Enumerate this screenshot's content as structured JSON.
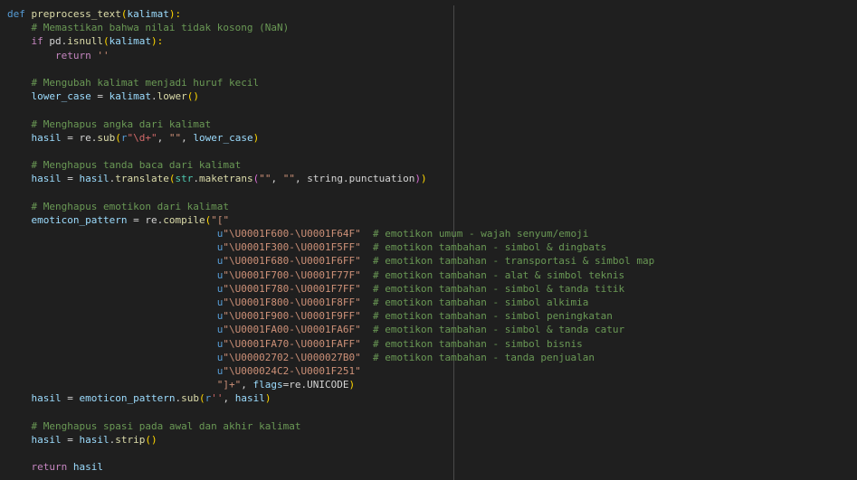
{
  "editor": {
    "lines": [
      [
        {
          "t": "def",
          "c": "kw"
        },
        {
          "t": " ",
          "c": "pl"
        },
        {
          "t": "preprocess_text",
          "c": "fn"
        },
        {
          "t": "(",
          "c": "br1"
        },
        {
          "t": "kalimat",
          "c": "var"
        },
        {
          "t": "):",
          "c": "br1"
        }
      ],
      [
        {
          "t": "    ",
          "c": "pl"
        },
        {
          "t": "# Memastikan bahwa nilai tidak kosong (NaN)",
          "c": "cm"
        }
      ],
      [
        {
          "t": "    ",
          "c": "pl"
        },
        {
          "t": "if",
          "c": "ctl"
        },
        {
          "t": " pd.",
          "c": "pl"
        },
        {
          "t": "isnull",
          "c": "fn"
        },
        {
          "t": "(",
          "c": "br1"
        },
        {
          "t": "kalimat",
          "c": "var"
        },
        {
          "t": "):",
          "c": "br1"
        }
      ],
      [
        {
          "t": "        ",
          "c": "pl"
        },
        {
          "t": "return",
          "c": "ctl"
        },
        {
          "t": " ",
          "c": "pl"
        },
        {
          "t": "''",
          "c": "str"
        }
      ],
      [],
      [
        {
          "t": "    ",
          "c": "pl"
        },
        {
          "t": "# Mengubah kalimat menjadi huruf kecil",
          "c": "cm"
        }
      ],
      [
        {
          "t": "    ",
          "c": "pl"
        },
        {
          "t": "lower_case",
          "c": "var"
        },
        {
          "t": " = ",
          "c": "pl"
        },
        {
          "t": "kalimat",
          "c": "var"
        },
        {
          "t": ".",
          "c": "pl"
        },
        {
          "t": "lower",
          "c": "fn"
        },
        {
          "t": "()",
          "c": "br1"
        }
      ],
      [],
      [
        {
          "t": "    ",
          "c": "pl"
        },
        {
          "t": "# Menghapus angka dari kalimat",
          "c": "cm"
        }
      ],
      [
        {
          "t": "    ",
          "c": "pl"
        },
        {
          "t": "hasil",
          "c": "var"
        },
        {
          "t": " = re.",
          "c": "pl"
        },
        {
          "t": "sub",
          "c": "fn"
        },
        {
          "t": "(",
          "c": "br1"
        },
        {
          "t": "r",
          "c": "kw"
        },
        {
          "t": "\"\\d+\"",
          "c": "rx"
        },
        {
          "t": ", ",
          "c": "pl"
        },
        {
          "t": "\"\"",
          "c": "str"
        },
        {
          "t": ", ",
          "c": "pl"
        },
        {
          "t": "lower_case",
          "c": "var"
        },
        {
          "t": ")",
          "c": "br1"
        }
      ],
      [],
      [
        {
          "t": "    ",
          "c": "pl"
        },
        {
          "t": "# Menghapus tanda baca dari kalimat",
          "c": "cm"
        }
      ],
      [
        {
          "t": "    ",
          "c": "pl"
        },
        {
          "t": "hasil",
          "c": "var"
        },
        {
          "t": " = ",
          "c": "pl"
        },
        {
          "t": "hasil",
          "c": "var"
        },
        {
          "t": ".",
          "c": "pl"
        },
        {
          "t": "translate",
          "c": "fn"
        },
        {
          "t": "(",
          "c": "br1"
        },
        {
          "t": "str",
          "c": "bi"
        },
        {
          "t": ".",
          "c": "pl"
        },
        {
          "t": "maketrans",
          "c": "fn"
        },
        {
          "t": "(",
          "c": "br2"
        },
        {
          "t": "\"\"",
          "c": "str"
        },
        {
          "t": ", ",
          "c": "pl"
        },
        {
          "t": "\"\"",
          "c": "str"
        },
        {
          "t": ", string.punctuation",
          "c": "pl"
        },
        {
          "t": ")",
          "c": "br2"
        },
        {
          "t": ")",
          "c": "br1"
        }
      ],
      [],
      [
        {
          "t": "    ",
          "c": "pl"
        },
        {
          "t": "# Menghapus emotikon dari kalimat",
          "c": "cm"
        }
      ],
      [
        {
          "t": "    ",
          "c": "pl"
        },
        {
          "t": "emoticon_pattern",
          "c": "var"
        },
        {
          "t": " = re.",
          "c": "pl"
        },
        {
          "t": "compile",
          "c": "fn"
        },
        {
          "t": "(",
          "c": "br1"
        },
        {
          "t": "\"[\"",
          "c": "str"
        }
      ],
      [
        {
          "t": "                                   ",
          "c": "pl"
        },
        {
          "t": "u",
          "c": "kw"
        },
        {
          "t": "\"\\U0001F600-\\U0001F64F\"",
          "c": "str"
        },
        {
          "t": "  ",
          "c": "pl"
        },
        {
          "t": "# emotikon umum - wajah senyum/emoji",
          "c": "cm"
        }
      ],
      [
        {
          "t": "                                   ",
          "c": "pl"
        },
        {
          "t": "u",
          "c": "kw"
        },
        {
          "t": "\"\\U0001F300-\\U0001F5FF\"",
          "c": "str"
        },
        {
          "t": "  ",
          "c": "pl"
        },
        {
          "t": "# emotikon tambahan - simbol & dingbats",
          "c": "cm"
        }
      ],
      [
        {
          "t": "                                   ",
          "c": "pl"
        },
        {
          "t": "u",
          "c": "kw"
        },
        {
          "t": "\"\\U0001F680-\\U0001F6FF\"",
          "c": "str"
        },
        {
          "t": "  ",
          "c": "pl"
        },
        {
          "t": "# emotikon tambahan - transportasi & simbol map",
          "c": "cm"
        }
      ],
      [
        {
          "t": "                                   ",
          "c": "pl"
        },
        {
          "t": "u",
          "c": "kw"
        },
        {
          "t": "\"\\U0001F700-\\U0001F77F\"",
          "c": "str"
        },
        {
          "t": "  ",
          "c": "pl"
        },
        {
          "t": "# emotikon tambahan - alat & simbol teknis",
          "c": "cm"
        }
      ],
      [
        {
          "t": "                                   ",
          "c": "pl"
        },
        {
          "t": "u",
          "c": "kw"
        },
        {
          "t": "\"\\U0001F780-\\U0001F7FF\"",
          "c": "str"
        },
        {
          "t": "  ",
          "c": "pl"
        },
        {
          "t": "# emotikon tambahan - simbol & tanda titik",
          "c": "cm"
        }
      ],
      [
        {
          "t": "                                   ",
          "c": "pl"
        },
        {
          "t": "u",
          "c": "kw"
        },
        {
          "t": "\"\\U0001F800-\\U0001F8FF\"",
          "c": "str"
        },
        {
          "t": "  ",
          "c": "pl"
        },
        {
          "t": "# emotikon tambahan - simbol alkimia",
          "c": "cm"
        }
      ],
      [
        {
          "t": "                                   ",
          "c": "pl"
        },
        {
          "t": "u",
          "c": "kw"
        },
        {
          "t": "\"\\U0001F900-\\U0001F9FF\"",
          "c": "str"
        },
        {
          "t": "  ",
          "c": "pl"
        },
        {
          "t": "# emotikon tambahan - simbol peningkatan",
          "c": "cm"
        }
      ],
      [
        {
          "t": "                                   ",
          "c": "pl"
        },
        {
          "t": "u",
          "c": "kw"
        },
        {
          "t": "\"\\U0001FA00-\\U0001FA6F\"",
          "c": "str"
        },
        {
          "t": "  ",
          "c": "pl"
        },
        {
          "t": "# emotikon tambahan - simbol & tanda catur",
          "c": "cm"
        }
      ],
      [
        {
          "t": "                                   ",
          "c": "pl"
        },
        {
          "t": "u",
          "c": "kw"
        },
        {
          "t": "\"\\U0001FA70-\\U0001FAFF\"",
          "c": "str"
        },
        {
          "t": "  ",
          "c": "pl"
        },
        {
          "t": "# emotikon tambahan - simbol bisnis",
          "c": "cm"
        }
      ],
      [
        {
          "t": "                                   ",
          "c": "pl"
        },
        {
          "t": "u",
          "c": "kw"
        },
        {
          "t": "\"\\U00002702-\\U000027B0\"",
          "c": "str"
        },
        {
          "t": "  ",
          "c": "pl"
        },
        {
          "t": "# emotikon tambahan - tanda penjualan",
          "c": "cm"
        }
      ],
      [
        {
          "t": "                                   ",
          "c": "pl"
        },
        {
          "t": "u",
          "c": "kw"
        },
        {
          "t": "\"\\U000024C2-\\U0001F251\"",
          "c": "str"
        }
      ],
      [
        {
          "t": "                                   ",
          "c": "pl"
        },
        {
          "t": "\"]+\"",
          "c": "str"
        },
        {
          "t": ", ",
          "c": "pl"
        },
        {
          "t": "flags",
          "c": "var"
        },
        {
          "t": "=re.UNICODE",
          "c": "pl"
        },
        {
          "t": ")",
          "c": "br1"
        }
      ],
      [
        {
          "t": "    ",
          "c": "pl"
        },
        {
          "t": "hasil",
          "c": "var"
        },
        {
          "t": " = ",
          "c": "pl"
        },
        {
          "t": "emoticon_pattern",
          "c": "var"
        },
        {
          "t": ".",
          "c": "pl"
        },
        {
          "t": "sub",
          "c": "fn"
        },
        {
          "t": "(",
          "c": "br1"
        },
        {
          "t": "r",
          "c": "kw"
        },
        {
          "t": "''",
          "c": "rx"
        },
        {
          "t": ", ",
          "c": "pl"
        },
        {
          "t": "hasil",
          "c": "var"
        },
        {
          "t": ")",
          "c": "br1"
        }
      ],
      [],
      [
        {
          "t": "    ",
          "c": "pl"
        },
        {
          "t": "# Menghapus spasi pada awal dan akhir kalimat",
          "c": "cm"
        }
      ],
      [
        {
          "t": "    ",
          "c": "pl"
        },
        {
          "t": "hasil",
          "c": "var"
        },
        {
          "t": " = ",
          "c": "pl"
        },
        {
          "t": "hasil",
          "c": "var"
        },
        {
          "t": ".",
          "c": "pl"
        },
        {
          "t": "strip",
          "c": "fn"
        },
        {
          "t": "()",
          "c": "br1"
        }
      ],
      [],
      [
        {
          "t": "    ",
          "c": "pl"
        },
        {
          "t": "return",
          "c": "ctl"
        },
        {
          "t": " ",
          "c": "pl"
        },
        {
          "t": "hasil",
          "c": "var"
        }
      ]
    ]
  }
}
